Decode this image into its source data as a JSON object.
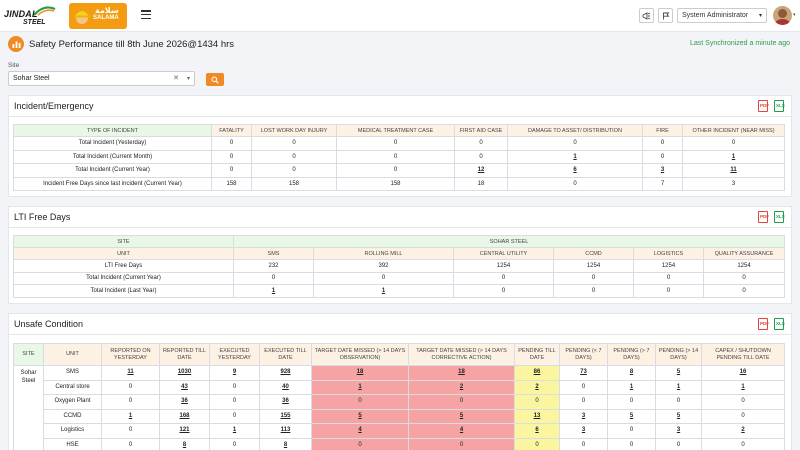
{
  "header": {
    "brand_top": "JINDAL",
    "brand_bottom": "STEEL",
    "salama_arabic": "سلامة",
    "salama_label": "SALAMA",
    "role": "System Administrator"
  },
  "page": {
    "title": "Safety Performance till 8th June 2026@1434 hrs",
    "sync": "Last Synchronized a minute ago"
  },
  "filter": {
    "site_label": "Site",
    "site_value": "Sohar Steel"
  },
  "incident": {
    "title": "Incident/Emergency",
    "headers": [
      "TYPE OF INCIDENT",
      "FATALITY",
      "LOST WORK DAY INJURY",
      "MEDICAL TREATMENT CASE",
      "FIRST AID CASE",
      "DAMAGE TO ASSET/ DISTRIBUTION",
      "FIRE",
      "OTHER INCIDENT (NEAR MISS)"
    ],
    "rows": [
      [
        "Total Incident (Yesterday)",
        "0",
        "0",
        "0",
        "0",
        "0",
        "0",
        "0"
      ],
      [
        "Total Incident (Current Month)",
        "0",
        "0",
        "0",
        "0",
        "1",
        "0",
        "1"
      ],
      [
        "Total Incident (Current Year)",
        "0",
        "0",
        "0",
        "12",
        "6",
        "3",
        "11"
      ],
      [
        "Incident Free Days since last incident (Current Year)",
        "158",
        "158",
        "158",
        "18",
        "0",
        "7",
        "3"
      ]
    ]
  },
  "lti": {
    "title": "LTI Free Days",
    "site_head": "SITE",
    "site_name": "SOHAR STEEL",
    "unit_head": "UNIT",
    "units": [
      "SMS",
      "ROLLING MILL",
      "CENTRAL UTILITY",
      "CCMD",
      "LOGISTICS",
      "QUALITY ASSURANCE"
    ],
    "rows": [
      [
        "LTI Free Days",
        "232",
        "392",
        "1254",
        "1254",
        "1254",
        "1254"
      ],
      [
        "Total Incident (Current Year)",
        "0",
        "0",
        "0",
        "0",
        "0",
        "0"
      ],
      [
        "Total Incident (Last Year)",
        "1",
        "1",
        "0",
        "0",
        "0",
        "0"
      ]
    ]
  },
  "unsafe": {
    "title": "Unsafe Condition",
    "site_cell": "Sohar Steel",
    "headers": [
      "SITE",
      "UNIT",
      "REPORTED ON YESTERDAY",
      "REPORTED TILL DATE",
      "EXECUTED YESTERDAY",
      "EXECUTED TILL DATE",
      "TARGET DATE MISSED (> 14 DAYS OBSERVATION)",
      "TARGET DATE MISSED (> 14 DAYS CORRECTIVE ACTION)",
      "PENDING TILL DATE",
      "PENDING (< 7 DAYS)",
      "PENDING (> 7 DAYS)",
      "PENDING (> 14 DAYS)",
      "CAPEX / SHUTDOWN PENDING TILL DATE"
    ],
    "rows": [
      [
        "SMS",
        "11",
        "1030",
        "9",
        "928",
        "18",
        "18",
        "86",
        "73",
        "8",
        "5",
        "16"
      ],
      [
        "Central store",
        "0",
        "43",
        "0",
        "40",
        "1",
        "2",
        "2",
        "0",
        "1",
        "1",
        "1"
      ],
      [
        "Oxygen Plant",
        "0",
        "36",
        "0",
        "36",
        "0",
        "0",
        "0",
        "0",
        "0",
        "0",
        "0"
      ],
      [
        "CCMD",
        "1",
        "168",
        "0",
        "155",
        "5",
        "5",
        "13",
        "3",
        "5",
        "5",
        "0"
      ],
      [
        "Logistics",
        "0",
        "121",
        "1",
        "113",
        "4",
        "4",
        "6",
        "3",
        "0",
        "3",
        "2"
      ],
      [
        "HSE",
        "0",
        "8",
        "0",
        "8",
        "0",
        "0",
        "0",
        "0",
        "0",
        "0",
        "0"
      ]
    ]
  }
}
